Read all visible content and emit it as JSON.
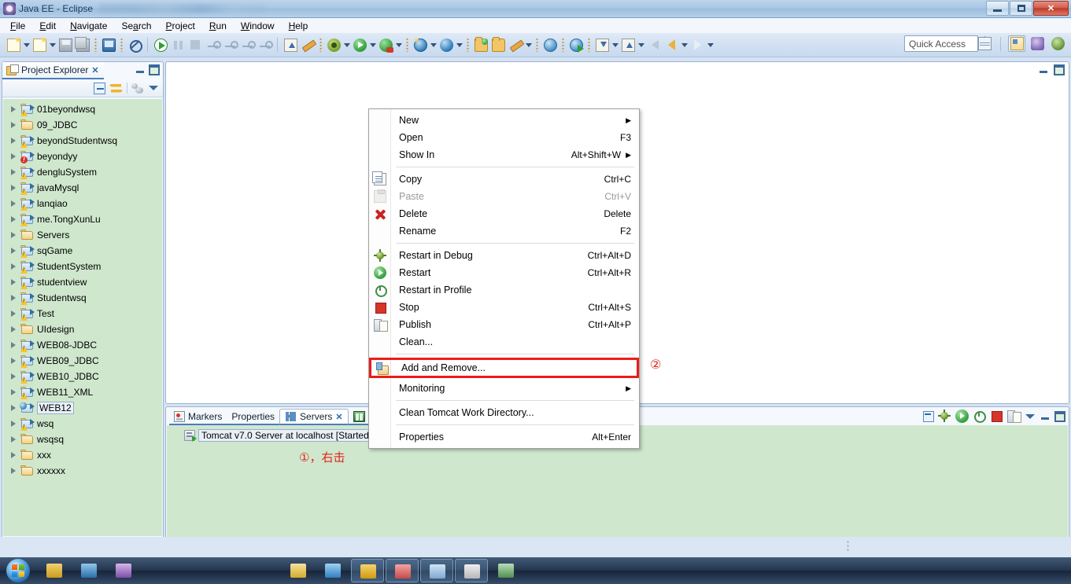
{
  "window": {
    "title": "Java EE - Eclipse",
    "app_icon": "eclipse-icon",
    "minimize_label": "",
    "maximize_label": "",
    "close_label": "✕"
  },
  "menubar": {
    "items": [
      {
        "label": "File",
        "mnemonic": "F"
      },
      {
        "label": "Edit",
        "mnemonic": "E"
      },
      {
        "label": "Navigate",
        "mnemonic": "N"
      },
      {
        "label": "Search",
        "mnemonic": "a"
      },
      {
        "label": "Project",
        "mnemonic": "P"
      },
      {
        "label": "Run",
        "mnemonic": "R"
      },
      {
        "label": "Window",
        "mnemonic": "W"
      },
      {
        "label": "Help",
        "mnemonic": "H"
      }
    ]
  },
  "toolbar": {
    "quick_access_placeholder": "Quick Access",
    "quick_access_value": "",
    "icons": [
      "new-wizard-icon",
      "new-dropdown-icon",
      "new-file-icon",
      "new-file-dropdown-icon",
      "save-icon",
      "save-all-icon",
      "open-console-icon",
      "skip-breakpoints-icon",
      "resume-icon",
      "suspend-icon",
      "terminate-icon",
      "step-into-icon",
      "step-over-icon",
      "step-return-icon",
      "step-filter-icon",
      "run-last-tool-icon",
      "external-tools-icon",
      "debug-icon",
      "debug-dropdown-icon",
      "run-icon",
      "run-dropdown-icon",
      "run-server-icon",
      "run-server-dropdown-icon",
      "new-web-project-icon",
      "new-web-project-dropdown-icon",
      "search-struts-icon",
      "search-struts-dropdown-icon",
      "open-type-icon",
      "open-task-icon",
      "edit-icon",
      "edit-dropdown-icon",
      "open-web-browser-icon",
      "open-web-service-icon",
      "import-icon",
      "import-dropdown-icon",
      "export-icon",
      "export-dropdown-icon",
      "back-icon",
      "forward-icon",
      "forward-dropdown-icon"
    ],
    "perspective_icons": [
      "open-perspective-icon",
      "java-ee-perspective-icon",
      "java-perspective-icon",
      "debug-perspective-icon"
    ]
  },
  "project_explorer": {
    "tab_label": "Project Explorer",
    "tab_icon": "project-explorer-icon",
    "close_icon": "✕",
    "view_buttons": [
      "minimize-view-icon",
      "maximize-view-icon"
    ],
    "toolbar_icons": [
      "collapse-all-icon",
      "link-with-editor-icon",
      "focus-on-active-task-icon",
      "view-menu-icon"
    ],
    "projects": [
      {
        "name": "01beyondwsq",
        "icon": "project-warning-icon",
        "state": "warning"
      },
      {
        "name": "09_JDBC",
        "icon": "folder-icon",
        "state": "plain"
      },
      {
        "name": "beyondStudentwsq",
        "icon": "project-warning-icon",
        "state": "warning"
      },
      {
        "name": "beyondyy",
        "icon": "project-error-icon",
        "state": "error"
      },
      {
        "name": "dengluSystem",
        "icon": "project-warning-icon",
        "state": "warning"
      },
      {
        "name": "javaMysql",
        "icon": "project-warning-icon",
        "state": "warning"
      },
      {
        "name": "lanqiao",
        "icon": "project-warning-icon",
        "state": "warning"
      },
      {
        "name": "me.TongXunLu",
        "icon": "project-warning-icon",
        "state": "warning"
      },
      {
        "name": "Servers",
        "icon": "folder-icon",
        "state": "plain"
      },
      {
        "name": "sqGame",
        "icon": "project-warning-icon",
        "state": "warning"
      },
      {
        "name": "StudentSystem",
        "icon": "project-warning-icon",
        "state": "warning"
      },
      {
        "name": "studentview",
        "icon": "project-warning-icon",
        "state": "warning"
      },
      {
        "name": "Studentwsq",
        "icon": "project-warning-icon",
        "state": "warning"
      },
      {
        "name": "Test",
        "icon": "project-warning-icon",
        "state": "warning"
      },
      {
        "name": "UIdesign",
        "icon": "folder-icon",
        "state": "plain"
      },
      {
        "name": "WEB08-JDBC",
        "icon": "project-warning-icon",
        "state": "warning"
      },
      {
        "name": "WEB09_JDBC",
        "icon": "project-warning-icon",
        "state": "warning"
      },
      {
        "name": "WEB10_JDBC",
        "icon": "project-warning-icon",
        "state": "warning"
      },
      {
        "name": "WEB11_XML",
        "icon": "project-warning-icon",
        "state": "warning"
      },
      {
        "name": "WEB12",
        "icon": "web-project-icon",
        "state": "selected"
      },
      {
        "name": "wsq",
        "icon": "project-warning-icon",
        "state": "warning"
      },
      {
        "name": "wsqsq",
        "icon": "folder-icon",
        "state": "plain"
      },
      {
        "name": "xxx",
        "icon": "folder-icon",
        "state": "plain"
      },
      {
        "name": "xxxxxx",
        "icon": "folder-icon",
        "state": "plain"
      }
    ],
    "hscroll": {
      "left_arrow": "scroll-left-icon",
      "right_arrow": "scroll-right-icon"
    }
  },
  "editor": {
    "view_buttons": [
      "minimize-editor-icon",
      "maximize-editor-icon"
    ]
  },
  "servers_view": {
    "tabs": [
      {
        "label": "Markers",
        "icon": "markers-icon",
        "active": false
      },
      {
        "label": "Properties",
        "icon": "",
        "active": false
      },
      {
        "label": "Servers",
        "icon": "servers-icon",
        "active": true,
        "close_icon": "✕"
      },
      {
        "label": "",
        "icon": "snippets-icon",
        "active": false
      }
    ],
    "toolbar_icons": [
      "collapse-all-icon",
      "start-debug-icon",
      "start-icon",
      "start-profile-icon",
      "stop-icon",
      "publish-icon",
      "view-menu-icon",
      "minimize-view-icon",
      "maximize-view-icon"
    ],
    "server_entry": {
      "name": "Tomcat v7.0 Server at localhost",
      "status": "[Started, Synchronized]",
      "icon": "tomcat-server-started-icon"
    }
  },
  "context_menu": {
    "groups": [
      {
        "items": [
          {
            "label": "New",
            "shortcut": "",
            "submenu": true,
            "icon": "",
            "disabled": false
          },
          {
            "label": "Open",
            "shortcut": "F3",
            "submenu": false,
            "icon": "",
            "disabled": false
          },
          {
            "label": "Show In",
            "shortcut": "Alt+Shift+W",
            "submenu": true,
            "icon": "",
            "disabled": false
          }
        ]
      },
      {
        "items": [
          {
            "label": "Copy",
            "shortcut": "Ctrl+C",
            "submenu": false,
            "icon": "copy-icon",
            "disabled": false
          },
          {
            "label": "Paste",
            "shortcut": "Ctrl+V",
            "submenu": false,
            "icon": "paste-icon",
            "disabled": true
          },
          {
            "label": "Delete",
            "shortcut": "Delete",
            "submenu": false,
            "icon": "delete-icon",
            "disabled": false
          },
          {
            "label": "Rename",
            "shortcut": "F2",
            "submenu": false,
            "icon": "",
            "disabled": false
          }
        ]
      },
      {
        "items": [
          {
            "label": "Restart in Debug",
            "shortcut": "Ctrl+Alt+D",
            "submenu": false,
            "icon": "restart-debug-icon",
            "disabled": false
          },
          {
            "label": "Restart",
            "shortcut": "Ctrl+Alt+R",
            "submenu": false,
            "icon": "restart-icon",
            "disabled": false
          },
          {
            "label": "Restart in Profile",
            "shortcut": "",
            "submenu": false,
            "icon": "restart-profile-icon",
            "disabled": false
          },
          {
            "label": "Stop",
            "shortcut": "Ctrl+Alt+S",
            "submenu": false,
            "icon": "stop-icon",
            "disabled": false
          },
          {
            "label": "Publish",
            "shortcut": "Ctrl+Alt+P",
            "submenu": false,
            "icon": "publish-icon",
            "disabled": false
          },
          {
            "label": "Clean...",
            "shortcut": "",
            "submenu": false,
            "icon": "",
            "disabled": false
          }
        ]
      }
    ],
    "highlighted_item": {
      "label": "Add and Remove...",
      "shortcut": "",
      "icon": "add-and-remove-icon",
      "highlight_color": "#ee1c19"
    },
    "after_highlight": [
      {
        "label": "Monitoring",
        "shortcut": "",
        "submenu": true,
        "icon": "",
        "disabled": false
      }
    ],
    "tail_groups": [
      {
        "items": [
          {
            "label": "Clean Tomcat Work Directory...",
            "shortcut": "",
            "submenu": false,
            "icon": "",
            "disabled": false
          }
        ]
      },
      {
        "items": [
          {
            "label": "Properties",
            "shortcut": "Alt+Enter",
            "submenu": false,
            "icon": "",
            "disabled": false
          }
        ]
      }
    ]
  },
  "annotations": [
    {
      "id": "step-1",
      "text": "①，右击",
      "color": "#e2231a"
    },
    {
      "id": "step-2",
      "text": "②",
      "color": "#e2231a"
    }
  ],
  "taskbar": {
    "start_icon": "windows-start-orb"
  }
}
